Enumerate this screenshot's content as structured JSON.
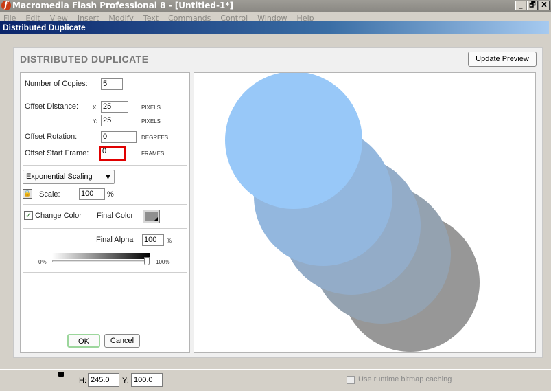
{
  "app": {
    "title": "Macromedia Flash Professional 8 - [Untitled-1*]",
    "window_buttons": [
      "_",
      "🗗",
      "X"
    ],
    "menu": [
      "File",
      "Edit",
      "View",
      "Insert",
      "Modify",
      "Text",
      "Commands",
      "Control",
      "Window",
      "Help"
    ]
  },
  "dialog": {
    "title": "Distributed Duplicate",
    "heading": "DISTRIBUTED DUPLICATE",
    "update_preview": "Update Preview",
    "copies_label": "Number of Copies:",
    "copies_value": "5",
    "offset_distance_label": "Offset Distance:",
    "x_label": "X:",
    "x_value": "25",
    "y_label": "Y:",
    "y_value": "25",
    "pixels_unit": "PIXELS",
    "offset_rotation_label": "Offset Rotation:",
    "rotation_value": "0",
    "degrees_unit": "DEGREES",
    "offset_start_label": "Offset Start Frame:",
    "start_frame_value": "0",
    "frames_unit": "FRAMES",
    "scaling_selected": "Exponential Scaling",
    "scale_label": "Scale:",
    "scale_value": "100",
    "percent": "%",
    "change_color_label": "Change Color",
    "change_color_checked": true,
    "final_color_label": "Final Color",
    "final_color": "#8f8f8f",
    "final_alpha_label": "Final Alpha",
    "final_alpha_value": "100",
    "alpha_min": "0%",
    "alpha_max": "100%",
    "alpha_level_fraction": 1.0,
    "ok": "OK",
    "cancel": "Cancel"
  },
  "preview": {
    "circles": [
      {
        "fill": "#979797"
      },
      {
        "fill": "#94a2b0"
      },
      {
        "fill": "#93acc8"
      },
      {
        "fill": "#93b7de"
      },
      {
        "fill": "#98c8f8"
      }
    ]
  },
  "statusbar": {
    "h_label": "H:",
    "h_value": "245.0",
    "y_label": "Y:",
    "y_value": "100.0",
    "bitmap_caching": "Use runtime bitmap caching"
  }
}
